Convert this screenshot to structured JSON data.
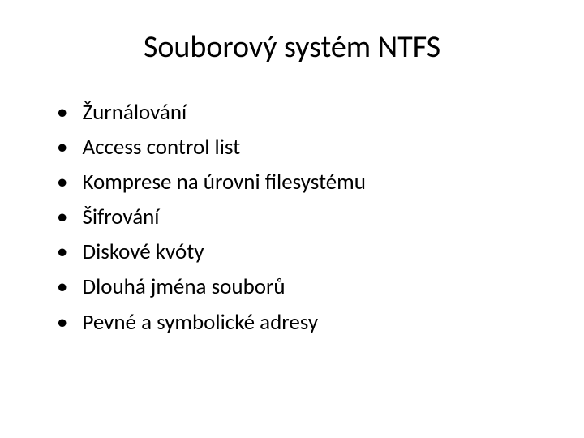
{
  "slide": {
    "title": "Souborový systém NTFS",
    "bullets": [
      "Žurnálování",
      "Access control list",
      "Komprese na úrovni filesystému",
      "Šifrování",
      "Diskové kvóty",
      "Dlouhá jména souborů",
      "Pevné a symbolické adresy"
    ]
  }
}
